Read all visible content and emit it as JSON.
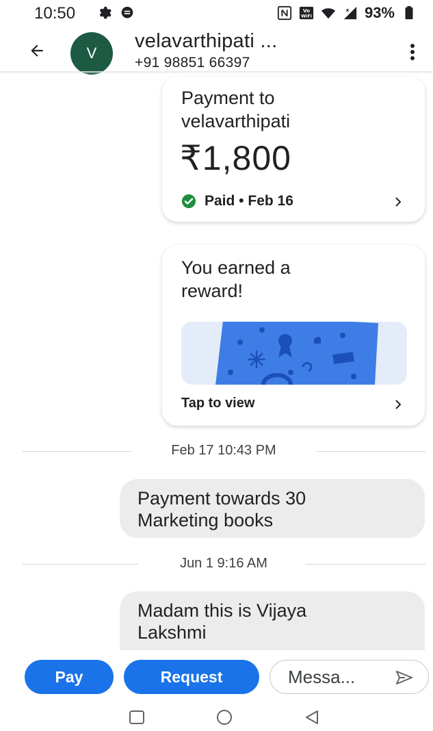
{
  "status_bar": {
    "time": "10:50",
    "battery": "93%",
    "icons": [
      "gear-icon",
      "message-notification-icon",
      "nfc-icon",
      "vowifi-icon",
      "wifi-icon",
      "signal-icon",
      "battery-icon"
    ]
  },
  "header": {
    "avatar_letter": "V",
    "avatar_color": "#1c5a43",
    "contact_name": "velavarthipati ...",
    "contact_phone": "+91 98851 66397"
  },
  "payment_card": {
    "title_line1": "Payment to",
    "title_line2": "velavarthipati",
    "amount": "₹1,800",
    "status": "Paid • Feb 16",
    "status_color": "#1e8e3e"
  },
  "reward_card": {
    "title_line1": "You earned a",
    "title_line2": "reward!",
    "action": "Tap to view"
  },
  "messages": [
    {
      "date": "Feb 17 10:43 PM",
      "text_line1": "Payment towards 30",
      "text_line2": "Marketing books"
    },
    {
      "date": "Jun 1 9:16 AM",
      "text_line1": "Madam this is Vijaya",
      "text_line2": "Lakshmi"
    }
  ],
  "actions": {
    "pay_label": "Pay",
    "request_label": "Request",
    "message_placeholder": "Messa...",
    "accent_color": "#1a73e8"
  },
  "nav_bar": {
    "icons": [
      "recents-square-icon",
      "home-circle-icon",
      "back-triangle-icon"
    ]
  }
}
